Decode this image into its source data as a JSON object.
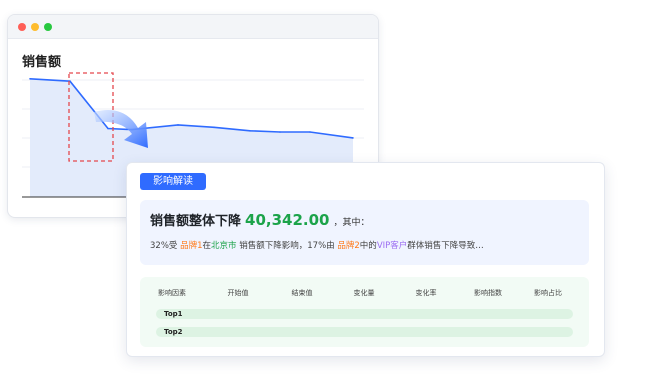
{
  "window": {
    "controls": [
      "close",
      "minimize",
      "maximize"
    ]
  },
  "chart": {
    "title": "销售额"
  },
  "chart_data": {
    "type": "area",
    "title": "销售额",
    "series": [
      {
        "values": [
          100,
          98,
          58,
          57,
          61,
          59,
          56,
          55,
          55,
          50
        ]
      }
    ],
    "highlight_range": [
      1,
      2
    ],
    "ylim": [
      0,
      110
    ],
    "grid": true,
    "colors": {
      "line": "#2f6bff",
      "fill": "#e3ebfb",
      "highlight": "#e5484d"
    }
  },
  "panel": {
    "badge": "影响解读",
    "headline": {
      "text": "销售额整体下降",
      "value": "40,342.00",
      "tail": "，其中："
    },
    "detail": {
      "p1": "32%受 ",
      "brand1": "品牌1",
      "p2": "在",
      "city": "北京市",
      "p3": " 销售额下降影响，17%由 ",
      "brand2": "品牌2",
      "p4": "中的",
      "segment": "VIP客户",
      "p5": "群体销售下降导致…"
    },
    "table": {
      "columns": [
        "影响因素",
        "开始值",
        "结束值",
        "变化量",
        "变化率",
        "影响指数",
        "影响占比"
      ],
      "rows": [
        {
          "label": "Top1"
        },
        {
          "label": "Top2"
        }
      ]
    }
  },
  "colors": {
    "accent": "#2f6bff",
    "positive_green": "#1ca34a",
    "brand_orange": "#ff7a1a",
    "segment_purple": "#9b6cf2"
  }
}
